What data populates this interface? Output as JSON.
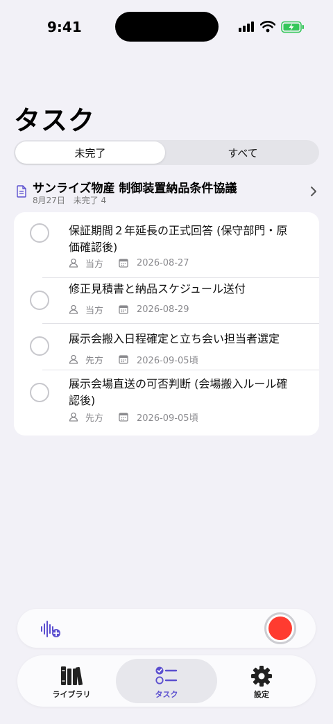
{
  "status_bar": {
    "time": "9:41"
  },
  "page": {
    "title": "タスク"
  },
  "segmented": {
    "incomplete": "未完了",
    "all": "すべて"
  },
  "section": {
    "title": "サンライズ物産 制御装置納品条件協議",
    "date": "8月27日",
    "count": "未完了 4"
  },
  "tasks": [
    {
      "title": "保証期間２年延長の正式回答 (保守部門・原価確認後)",
      "owner": "当方",
      "due": "2026-08-27",
      "completed": false
    },
    {
      "title": "修正見積書と納品スケジュール送付",
      "owner": "当方",
      "due": "2026-08-29",
      "completed": false
    },
    {
      "title": "展示会搬入日程確定と立ち会い担当者選定",
      "owner": "先方",
      "due": "2026-09-05頃",
      "completed": false
    },
    {
      "title": "展示会場直送の可否判断 (会場搬入ルール確認後)",
      "owner": "先方",
      "due": "2026-09-05頃",
      "completed": false
    }
  ],
  "tab_bar": {
    "library": "ライブラリ",
    "tasks": "タスク",
    "settings": "設定",
    "selected": "tasks"
  },
  "colors": {
    "accent": "#5b4fcf",
    "record": "#ff3b30",
    "background": "#f2f1f7",
    "battery": "#34c759"
  },
  "icons": {
    "document": "document-icon",
    "person": "person-icon",
    "calendar": "calendar-icon",
    "waveform": "waveform-add-icon",
    "library": "books-icon",
    "tasks": "checklist-icon",
    "settings": "gear-icon"
  }
}
